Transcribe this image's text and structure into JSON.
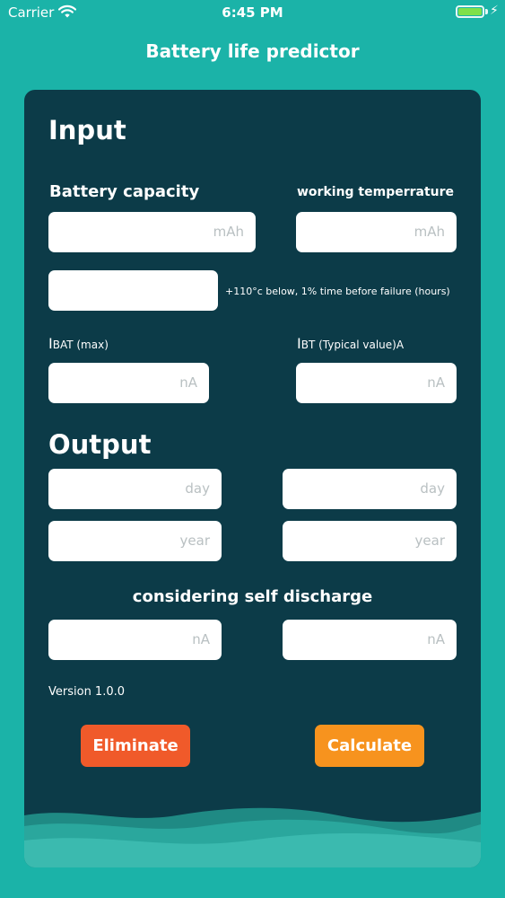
{
  "status_bar": {
    "carrier": "Carrier",
    "time": "6:45 PM"
  },
  "nav": {
    "title": "Battery life predictor"
  },
  "input": {
    "heading": "Input",
    "battery_capacity": {
      "label": "Battery capacity",
      "unit": "mAh"
    },
    "working_temperature": {
      "label": "working temperrature",
      "unit": "mAh"
    },
    "failure_time": {
      "value": "",
      "label": "+110°c below, 1% time before failure (hours)"
    },
    "ibat_max": {
      "symbol": "I",
      "subscript": "BAT (max)",
      "unit": "nA"
    },
    "ibt_typical": {
      "symbol": "I",
      "subscript": "BT (Typical value)A",
      "unit": "nA"
    }
  },
  "output": {
    "heading": "Output",
    "day_left": "day",
    "day_right": "day",
    "year_left": "year",
    "year_right": "year",
    "self_discharge_label": "considering self discharge",
    "na_left": "nA",
    "na_right": "nA"
  },
  "version": "Version 1.0.0",
  "buttons": {
    "eliminate": {
      "label": "Eliminate",
      "color": "#f05a2a"
    },
    "calculate": {
      "label": "Calculate",
      "color": "#f7931e"
    }
  },
  "colors": {
    "background": "#1bb3a8",
    "card": "#0c3b48"
  }
}
